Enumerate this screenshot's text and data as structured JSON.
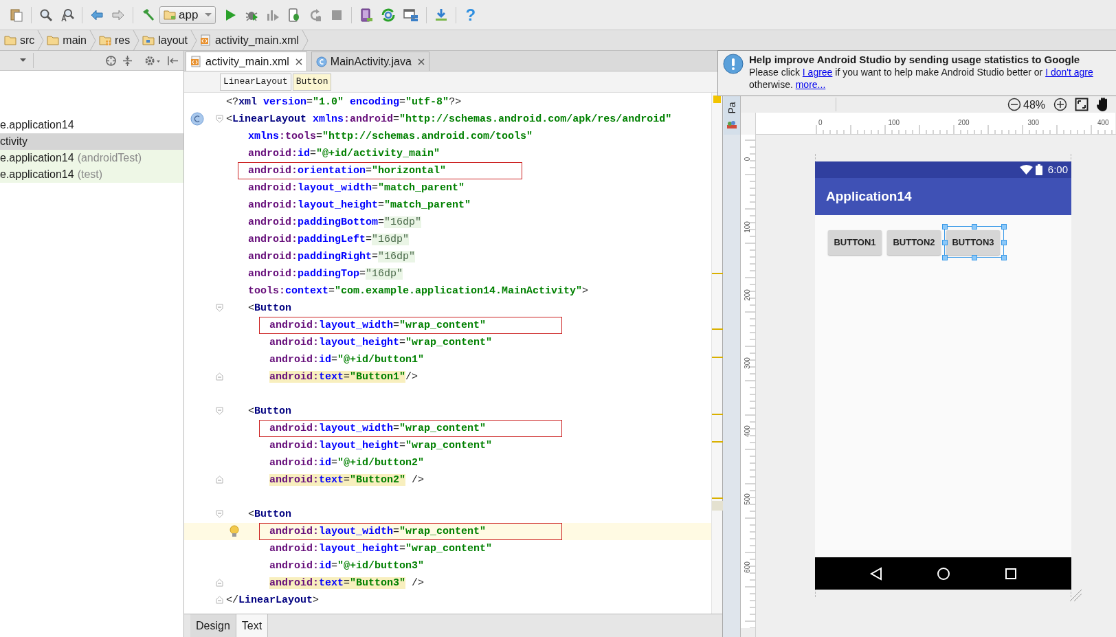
{
  "toolbar": {
    "run_config": "app",
    "help": "?"
  },
  "breadcrumbs": [
    {
      "label": "src",
      "kind": "folder"
    },
    {
      "label": "main",
      "kind": "folder"
    },
    {
      "label": "res",
      "kind": "res"
    },
    {
      "label": "layout",
      "kind": "layout"
    },
    {
      "label": "activity_main.xml",
      "kind": "xml"
    }
  ],
  "project_panel": {
    "items": [
      {
        "text": "e.application14",
        "selected": false,
        "kind": "main"
      },
      {
        "text": "ctivity",
        "selected": true,
        "kind": "main"
      },
      {
        "text": "e.application14",
        "suffix": "(androidTest)",
        "selected": false,
        "kind": "test"
      },
      {
        "text": "e.application14",
        "suffix": "(test)",
        "selected": false,
        "kind": "test"
      }
    ]
  },
  "editor_tabs": [
    {
      "label": "activity_main.xml",
      "kind": "xml",
      "selected": true
    },
    {
      "label": "MainActivity.java",
      "kind": "java",
      "selected": false
    }
  ],
  "tag_path": [
    {
      "label": "LinearLayout",
      "selected": false
    },
    {
      "label": "Button",
      "selected": true
    }
  ],
  "code_lines": [
    {
      "kind": "decl",
      "boxed": false,
      "current": false,
      "class_icon": false,
      "fold_start": false,
      "fold_end": false,
      "segments": [
        {
          "kind": "p",
          "text": "<?"
        },
        {
          "kind": "t",
          "text": "xml"
        },
        {
          "kind": "a",
          "text": " version"
        },
        {
          "kind": "p",
          "text": "="
        },
        {
          "kind": "v",
          "text": "\"1.0\""
        },
        {
          "kind": "a",
          "text": " encoding"
        },
        {
          "kind": "p",
          "text": "="
        },
        {
          "kind": "v",
          "text": "\"utf-8\""
        },
        {
          "kind": "p",
          "text": "?>"
        }
      ]
    },
    {
      "kind": "open",
      "boxed": false,
      "current": false,
      "class_icon": true,
      "fold_start": true,
      "fold_end": false,
      "segments": [
        {
          "kind": "p",
          "text": "<"
        },
        {
          "kind": "t",
          "text": "LinearLayout"
        },
        {
          "kind": "a",
          "text": " xmlns"
        },
        {
          "kind": "n",
          "text": ":android"
        },
        {
          "kind": "p",
          "text": "="
        },
        {
          "kind": "v",
          "text": "\"http://schemas.android.com/apk/res/android\""
        }
      ]
    },
    {
      "kind": "attr",
      "boxed": false,
      "current": false,
      "class_icon": false,
      "fold_start": false,
      "fold_end": false,
      "segments": [
        {
          "kind": "a",
          "text": "xmlns"
        },
        {
          "kind": "n",
          "text": ":tools"
        },
        {
          "kind": "p",
          "text": "="
        },
        {
          "kind": "v",
          "text": "\"http://schemas.android.com/tools\""
        }
      ]
    },
    {
      "kind": "attr",
      "boxed": false,
      "current": false,
      "class_icon": false,
      "fold_start": false,
      "fold_end": false,
      "segments": [
        {
          "kind": "n",
          "text": "android:"
        },
        {
          "kind": "a",
          "text": "id"
        },
        {
          "kind": "p",
          "text": "="
        },
        {
          "kind": "v",
          "text": "\"@+id/activity_main\""
        }
      ]
    },
    {
      "kind": "attr",
      "boxed": true,
      "current": false,
      "class_icon": false,
      "fold_start": false,
      "fold_end": false,
      "segments": [
        {
          "kind": "n",
          "text": "android:"
        },
        {
          "kind": "a",
          "text": "orientation"
        },
        {
          "kind": "p",
          "text": "="
        },
        {
          "kind": "v",
          "text": "\"horizontal\""
        }
      ]
    },
    {
      "kind": "attr",
      "boxed": false,
      "current": false,
      "class_icon": false,
      "fold_start": false,
      "fold_end": false,
      "segments": [
        {
          "kind": "n",
          "text": "android:"
        },
        {
          "kind": "a",
          "text": "layout_width"
        },
        {
          "kind": "p",
          "text": "="
        },
        {
          "kind": "v",
          "text": "\"match_parent\""
        }
      ]
    },
    {
      "kind": "attr",
      "boxed": false,
      "current": false,
      "class_icon": false,
      "fold_start": false,
      "fold_end": false,
      "segments": [
        {
          "kind": "n",
          "text": "android:"
        },
        {
          "kind": "a",
          "text": "layout_height"
        },
        {
          "kind": "p",
          "text": "="
        },
        {
          "kind": "v",
          "text": "\"match_parent\""
        }
      ]
    },
    {
      "kind": "attr",
      "boxed": false,
      "current": false,
      "class_icon": false,
      "fold_start": false,
      "fold_end": false,
      "segments": [
        {
          "kind": "n",
          "text": "android:"
        },
        {
          "kind": "a",
          "text": "paddingBottom"
        },
        {
          "kind": "p",
          "text": "="
        },
        {
          "kind": "i",
          "text": "\"16dp\""
        }
      ]
    },
    {
      "kind": "attr",
      "boxed": false,
      "current": false,
      "class_icon": false,
      "fold_start": false,
      "fold_end": false,
      "segments": [
        {
          "kind": "n",
          "text": "android:"
        },
        {
          "kind": "a",
          "text": "paddingLeft"
        },
        {
          "kind": "p",
          "text": "="
        },
        {
          "kind": "i",
          "text": "\"16dp\""
        }
      ]
    },
    {
      "kind": "attr",
      "boxed": false,
      "current": false,
      "class_icon": false,
      "fold_start": false,
      "fold_end": false,
      "segments": [
        {
          "kind": "n",
          "text": "android:"
        },
        {
          "kind": "a",
          "text": "paddingRight"
        },
        {
          "kind": "p",
          "text": "="
        },
        {
          "kind": "i",
          "text": "\"16dp\""
        }
      ]
    },
    {
      "kind": "attr",
      "boxed": false,
      "current": false,
      "class_icon": false,
      "fold_start": false,
      "fold_end": false,
      "segments": [
        {
          "kind": "n",
          "text": "android:"
        },
        {
          "kind": "a",
          "text": "paddingTop"
        },
        {
          "kind": "p",
          "text": "="
        },
        {
          "kind": "i",
          "text": "\"16dp\""
        }
      ]
    },
    {
      "kind": "attr",
      "boxed": false,
      "current": false,
      "class_icon": false,
      "fold_start": false,
      "fold_end": false,
      "segments": [
        {
          "kind": "n",
          "text": "tools:"
        },
        {
          "kind": "a",
          "text": "context"
        },
        {
          "kind": "p",
          "text": "="
        },
        {
          "kind": "v",
          "text": "\"com.example.application14.MainActivity\""
        },
        {
          "kind": "p",
          "text": ">"
        }
      ]
    },
    {
      "kind": "child",
      "boxed": false,
      "current": false,
      "class_icon": false,
      "fold_start": true,
      "fold_end": false,
      "segments": [
        {
          "kind": "p",
          "text": "<"
        },
        {
          "kind": "t",
          "text": "Button"
        }
      ]
    },
    {
      "kind": "childattr",
      "boxed": true,
      "current": false,
      "class_icon": false,
      "fold_start": false,
      "fold_end": false,
      "segments": [
        {
          "kind": "n",
          "text": "android:"
        },
        {
          "kind": "a",
          "text": "layout_width"
        },
        {
          "kind": "p",
          "text": "="
        },
        {
          "kind": "v",
          "text": "\"wrap_content\""
        }
      ]
    },
    {
      "kind": "childattr",
      "boxed": false,
      "current": false,
      "class_icon": false,
      "fold_start": false,
      "fold_end": false,
      "segments": [
        {
          "kind": "n",
          "text": "android:"
        },
        {
          "kind": "a",
          "text": "layout_height"
        },
        {
          "kind": "p",
          "text": "="
        },
        {
          "kind": "v",
          "text": "\"wrap_content\""
        }
      ]
    },
    {
      "kind": "childattr",
      "boxed": false,
      "current": false,
      "class_icon": false,
      "fold_start": false,
      "fold_end": false,
      "segments": [
        {
          "kind": "n",
          "text": "android:"
        },
        {
          "kind": "a",
          "text": "id"
        },
        {
          "kind": "p",
          "text": "="
        },
        {
          "kind": "v",
          "text": "\"@+id/button1\""
        }
      ]
    },
    {
      "kind": "childattr",
      "boxed": false,
      "current": false,
      "class_icon": false,
      "fold_start": false,
      "fold_end": true,
      "segments": [
        {
          "kind": "nm",
          "text": "android:"
        },
        {
          "kind": "am",
          "text": "text"
        },
        {
          "kind": "pm",
          "text": "="
        },
        {
          "kind": "vm",
          "text": "\"Button1\""
        },
        {
          "kind": "p",
          "text": "/>"
        }
      ]
    },
    {
      "kind": "blank",
      "boxed": false,
      "current": false,
      "class_icon": false,
      "fold_start": false,
      "fold_end": false
    },
    {
      "kind": "child",
      "boxed": false,
      "current": false,
      "class_icon": false,
      "fold_start": true,
      "fold_end": false,
      "segments": [
        {
          "kind": "p",
          "text": "<"
        },
        {
          "kind": "t",
          "text": "Button"
        }
      ]
    },
    {
      "kind": "childattr",
      "boxed": true,
      "current": false,
      "class_icon": false,
      "fold_start": false,
      "fold_end": false,
      "segments": [
        {
          "kind": "n",
          "text": "android:"
        },
        {
          "kind": "a",
          "text": "layout_width"
        },
        {
          "kind": "p",
          "text": "="
        },
        {
          "kind": "v",
          "text": "\"wrap_content\""
        }
      ]
    },
    {
      "kind": "childattr",
      "boxed": false,
      "current": false,
      "class_icon": false,
      "fold_start": false,
      "fold_end": false,
      "segments": [
        {
          "kind": "n",
          "text": "android:"
        },
        {
          "kind": "a",
          "text": "layout_height"
        },
        {
          "kind": "p",
          "text": "="
        },
        {
          "kind": "v",
          "text": "\"wrap_content\""
        }
      ]
    },
    {
      "kind": "childattr",
      "boxed": false,
      "current": false,
      "class_icon": false,
      "fold_start": false,
      "fold_end": false,
      "segments": [
        {
          "kind": "n",
          "text": "android:"
        },
        {
          "kind": "a",
          "text": "id"
        },
        {
          "kind": "p",
          "text": "="
        },
        {
          "kind": "v",
          "text": "\"@+id/button2\""
        }
      ]
    },
    {
      "kind": "childattr",
      "boxed": false,
      "current": false,
      "class_icon": false,
      "fold_start": false,
      "fold_end": true,
      "segments": [
        {
          "kind": "nm",
          "text": "android:"
        },
        {
          "kind": "am",
          "text": "text"
        },
        {
          "kind": "pm",
          "text": "="
        },
        {
          "kind": "vm",
          "text": "\"Button2\""
        },
        {
          "kind": "p",
          "text": " />"
        }
      ]
    },
    {
      "kind": "blank",
      "boxed": false,
      "current": false,
      "class_icon": false,
      "fold_start": false,
      "fold_end": false
    },
    {
      "kind": "child",
      "boxed": false,
      "current": false,
      "class_icon": false,
      "fold_start": true,
      "fold_end": false,
      "segments": [
        {
          "kind": "p",
          "text": "<"
        },
        {
          "kind": "t",
          "text": "Button"
        }
      ]
    },
    {
      "kind": "childattr",
      "boxed": true,
      "current": true,
      "class_icon": false,
      "fold_start": false,
      "fold_end": false,
      "segments": [
        {
          "kind": "n",
          "text": "android:"
        },
        {
          "kind": "a",
          "text": "layout_width"
        },
        {
          "kind": "p",
          "text": "="
        },
        {
          "kind": "v",
          "text": "\"wrap_content\""
        }
      ]
    },
    {
      "kind": "childattr",
      "boxed": false,
      "current": false,
      "class_icon": false,
      "fold_start": false,
      "fold_end": false,
      "segments": [
        {
          "kind": "n",
          "text": "android:"
        },
        {
          "kind": "a",
          "text": "layout_height"
        },
        {
          "kind": "p",
          "text": "="
        },
        {
          "kind": "v",
          "text": "\"wrap_content\""
        }
      ]
    },
    {
      "kind": "childattr",
      "boxed": false,
      "current": false,
      "class_icon": false,
      "fold_start": false,
      "fold_end": false,
      "segments": [
        {
          "kind": "n",
          "text": "android:"
        },
        {
          "kind": "a",
          "text": "id"
        },
        {
          "kind": "p",
          "text": "="
        },
        {
          "kind": "v",
          "text": "\"@+id/button3\""
        }
      ]
    },
    {
      "kind": "childattr",
      "boxed": false,
      "current": false,
      "class_icon": false,
      "fold_start": false,
      "fold_end": true,
      "segments": [
        {
          "kind": "nm",
          "text": "android:"
        },
        {
          "kind": "am",
          "text": "text"
        },
        {
          "kind": "pm",
          "text": "="
        },
        {
          "kind": "vm",
          "text": "\"Button3\""
        },
        {
          "kind": "p",
          "text": " />"
        }
      ]
    },
    {
      "kind": "close",
      "boxed": false,
      "current": false,
      "class_icon": false,
      "fold_start": false,
      "fold_end": true,
      "segments": [
        {
          "kind": "p",
          "text": "</"
        },
        {
          "kind": "t",
          "text": "LinearLayout"
        },
        {
          "kind": "p",
          "text": ">"
        }
      ]
    }
  ],
  "bottom_tabs": [
    {
      "label": "Design",
      "selected": false
    },
    {
      "label": "Text",
      "selected": true
    }
  ],
  "notification": {
    "title": "Help improve Android Studio by sending usage statistics to Google",
    "lines": [
      [
        {
          "kind": "text",
          "text": "Please click "
        },
        {
          "kind": "link",
          "text": "I agree"
        },
        {
          "kind": "text",
          "text": " if you want to help make Android Studio better or "
        },
        {
          "kind": "link",
          "text": "I don't agre"
        }
      ],
      [
        {
          "kind": "text",
          "text": "otherwise. "
        },
        {
          "kind": "link",
          "text": "more..."
        }
      ]
    ]
  },
  "designer": {
    "palette_tab": "Pa",
    "zoom": "48%",
    "ruler": {
      "horizontal": [
        "0",
        "100",
        "200",
        "300",
        "400"
      ],
      "vertical": [
        "0",
        "100",
        "200",
        "300",
        "400",
        "500",
        "600"
      ]
    },
    "preview": {
      "time": "6:00",
      "app_title": "Application14",
      "buttons": [
        {
          "label": "BUTTON1",
          "selected": false
        },
        {
          "label": "BUTTON2",
          "selected": false
        },
        {
          "label": "BUTTON3",
          "selected": true
        }
      ]
    }
  }
}
